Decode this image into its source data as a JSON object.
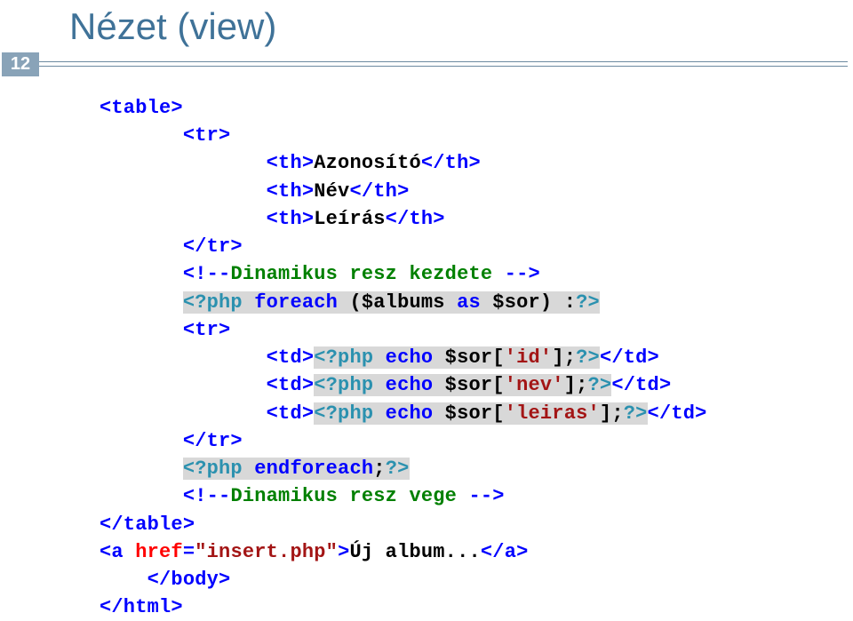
{
  "slide": {
    "title": "Nézet (view)",
    "number": "12"
  },
  "code": {
    "l1a": "<table>",
    "l2a": "<tr>",
    "l3a": "<th>",
    "l3b": "Azonosító",
    "l3c": "</th>",
    "l4a": "<th>",
    "l4b": "Név",
    "l4c": "</th>",
    "l5a": "<th>",
    "l5b": "Leírás",
    "l5c": "</th>",
    "l6a": "</tr>",
    "l7a": "<!--",
    "l7b": "Dinamikus resz kezdete ",
    "l7c": "-->",
    "l8a": "<?php",
    "l8b": " foreach",
    "l8c": " ($albums ",
    "l8d": "as",
    "l8e": " $sor) :",
    "l8f": "?>",
    "l9a": "<tr>",
    "l10a": "<td>",
    "l10b": "<?php",
    "l10c": " echo",
    "l10d": " $sor[",
    "l10e": "'id'",
    "l10f": "];",
    "l10g": "?>",
    "l10h": "</td>",
    "l11a": "<td>",
    "l11b": "<?php",
    "l11c": " echo",
    "l11d": " $sor[",
    "l11e": "'nev'",
    "l11f": "];",
    "l11g": "?>",
    "l11h": "</td>",
    "l12a": "<td>",
    "l12b": "<?php",
    "l12c": " echo",
    "l12d": " $sor[",
    "l12e": "'leiras'",
    "l12f": "];",
    "l12g": "?>",
    "l12h": "</td>",
    "l13a": "</tr>",
    "l14a": "<?php",
    "l14b": " endforeach",
    "l14c": ";",
    "l14d": "?>",
    "l15a": "<!--",
    "l15b": "Dinamikus resz vege ",
    "l15c": "-->",
    "l16a": "</table>",
    "l17a": "<a ",
    "l17b": "href",
    "l17c": "=",
    "l17d": "\"insert.php\"",
    "l17e": ">",
    "l17f": "Új album...",
    "l17g": "</a>",
    "l18a": "</body>",
    "l19a": "</html>"
  }
}
